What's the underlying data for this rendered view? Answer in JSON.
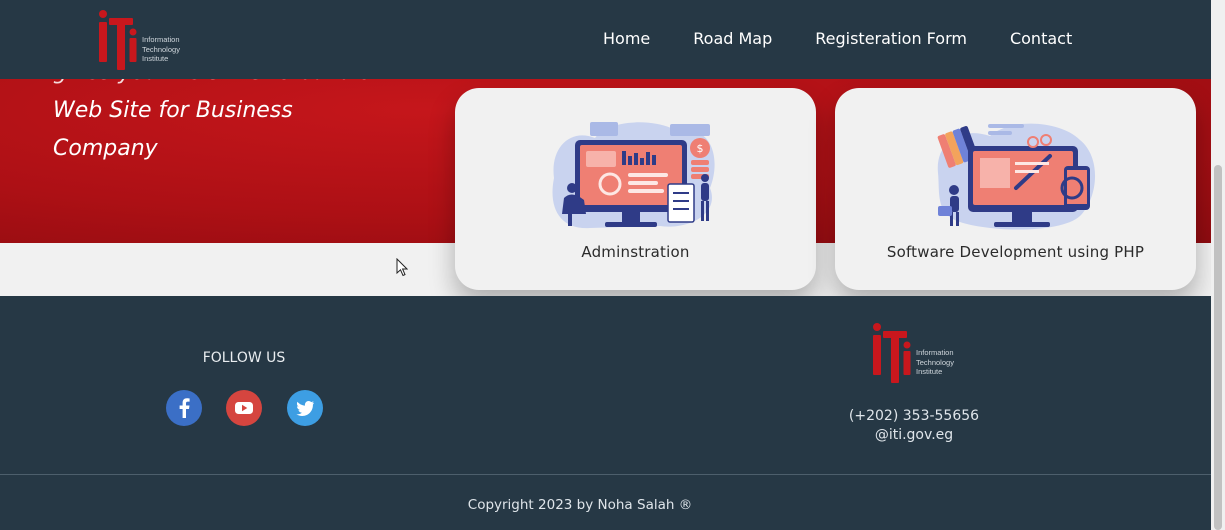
{
  "brand": {
    "logo_text_line1": "Information",
    "logo_text_line2": "Technology",
    "logo_text_line3": "Institute",
    "brand_red": "#c8171d",
    "header_bg": "#263845"
  },
  "nav": {
    "items": [
      "Home",
      "Road Map",
      "Registeration Form",
      "Contact"
    ]
  },
  "hero": {
    "partial_line": "gives you the skills to build a",
    "line1": "Web Site for Business",
    "line2": "Company"
  },
  "cards": [
    {
      "label": "Adminstration",
      "illustration": "dashboard-analytics-illustration"
    },
    {
      "label": "Software Development using PHP",
      "illustration": "design-development-illustration"
    }
  ],
  "footer": {
    "follow_title": "FOLLOW US",
    "social": [
      {
        "name": "facebook",
        "icon": "facebook-icon",
        "color": "#3b6fc6"
      },
      {
        "name": "youtube",
        "icon": "youtube-icon",
        "color": "#d5453f"
      },
      {
        "name": "twitter",
        "icon": "twitter-icon",
        "color": "#3d9ee3"
      }
    ],
    "phone": "(+202) 353-55656",
    "email": "@iti.gov.eg",
    "copyright": "Copyright 2023 by Noha Salah ®"
  }
}
